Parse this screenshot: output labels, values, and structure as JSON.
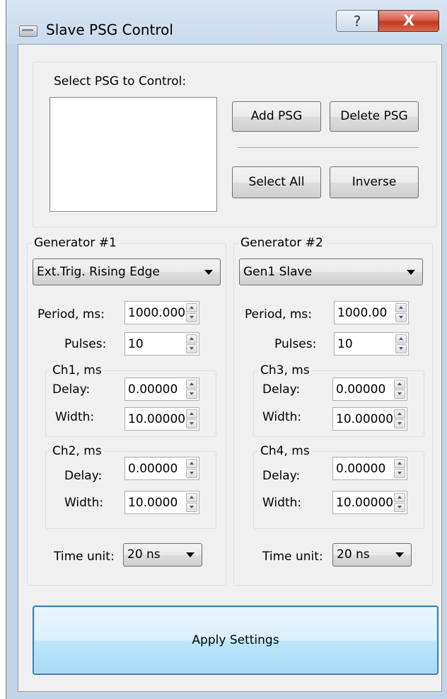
{
  "window": {
    "title": "Slave PSG Control",
    "help_glyph": "?",
    "close_glyph": "X"
  },
  "selector": {
    "label": "Select PSG to Control:",
    "items": [],
    "add_button": "Add PSG",
    "delete_button": "Delete PSG",
    "select_all_button": "Select All",
    "inverse_button": "Inverse"
  },
  "generators": [
    {
      "title": "Generator #1",
      "mode": "Ext.Trig. Rising Edge",
      "period_label": "Period, ms:",
      "period_value": "1000.000",
      "pulses_label": "Pulses:",
      "pulses_value": "10",
      "channels": [
        {
          "title": "Ch1, ms",
          "delay_label": "Delay:",
          "delay_value": "0.00000",
          "width_label": "Width:",
          "width_value": "10.00000"
        },
        {
          "title": "Ch2, ms",
          "delay_label": "Delay:",
          "delay_value": "0.00000",
          "width_label": "Width:",
          "width_value": "10.0000"
        }
      ],
      "time_unit_label": "Time unit:",
      "time_unit_value": "20 ns"
    },
    {
      "title": "Generator #2",
      "mode": "Gen1 Slave",
      "period_label": "Period, ms:",
      "period_value": "1000.00",
      "pulses_label": "Pulses:",
      "pulses_value": "10",
      "channels": [
        {
          "title": "Ch3, ms",
          "delay_label": "Delay:",
          "delay_value": "0.00000",
          "width_label": "Width:",
          "width_value": "10.00000"
        },
        {
          "title": "Ch4, ms",
          "delay_label": "Delay:",
          "delay_value": "0.00000",
          "width_label": "Width:",
          "width_value": "10.00000"
        }
      ],
      "time_unit_label": "Time unit:",
      "time_unit_value": "20 ns"
    }
  ],
  "apply_button": "Apply Settings",
  "colors": {
    "title_bar": "#c9daed",
    "close_button": "#c2381f",
    "client_bg": "#f0f0f0",
    "apply_border": "#3c7fb1"
  }
}
